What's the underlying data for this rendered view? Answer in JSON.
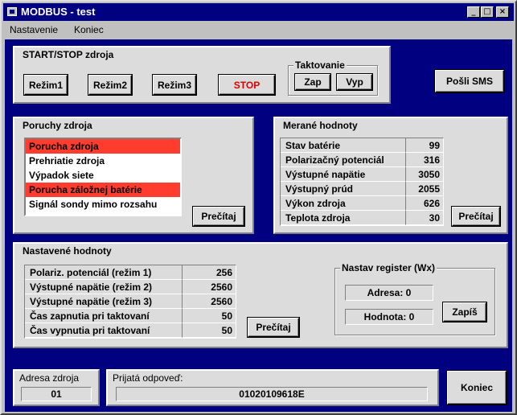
{
  "window": {
    "title": "MODBUS - test",
    "controls": {
      "minimize": "_",
      "maximize": "□",
      "close": "×"
    }
  },
  "menu": {
    "items": [
      "Nastavenie",
      "Koniec"
    ]
  },
  "startstop": {
    "title": "START/STOP zdroja",
    "buttons": [
      "Režim1",
      "Režim2",
      "Režim3",
      "STOP"
    ],
    "clocking": {
      "title": "Taktovanie",
      "on": "Zap",
      "off": "Vyp"
    }
  },
  "sms_button": "Pošli SMS",
  "faults": {
    "title": "Poruchy zdroja",
    "items": [
      {
        "label": "Porucha zdroja",
        "active": true
      },
      {
        "label": "Prehriatie zdroja",
        "active": false
      },
      {
        "label": "Výpadok siete",
        "active": false
      },
      {
        "label": "Porucha záložnej batérie",
        "active": true
      },
      {
        "label": "Signál sondy mimo rozsahu",
        "active": false
      }
    ],
    "read_button": "Prečítaj"
  },
  "measured": {
    "title": "Merané hodnoty",
    "rows": [
      {
        "label": "Stav batérie",
        "value": "99"
      },
      {
        "label": "Polarizačný potenciál",
        "value": "316"
      },
      {
        "label": "Výstupné napätie",
        "value": "3050"
      },
      {
        "label": "Výstupný prúd",
        "value": "2055"
      },
      {
        "label": "Výkon zdroja",
        "value": "626"
      },
      {
        "label": "Teplota zdroja",
        "value": "30"
      }
    ],
    "read_button": "Prečítaj"
  },
  "settings": {
    "title": "Nastavené hodnoty",
    "rows": [
      {
        "label": "Polariz. potenciál (režim 1)",
        "value": "256"
      },
      {
        "label": "Výstupné napätie (režim 2)",
        "value": "2560"
      },
      {
        "label": "Výstupné napätie (režim 3)",
        "value": "2560"
      },
      {
        "label": "Čas zapnutia pri taktovaní",
        "value": "50"
      },
      {
        "label": "Čas vypnutia pri taktovaní",
        "value": "50"
      }
    ],
    "read_button": "Prečítaj",
    "register": {
      "title": "Nastav register (Wx)",
      "address_label": "Adresa: 0",
      "value_label": "Hodnota: 0",
      "write_button": "Zapíš"
    }
  },
  "source_address": {
    "title": "Adresa zdroja",
    "value": "01"
  },
  "response": {
    "title": "Prijatá odpoveď:",
    "value": "01020109618E"
  },
  "exit_button": "Koniec",
  "colors": {
    "alarm": "#ff3c2d",
    "stop_text": "#e00000",
    "client_bg": "#000080",
    "titlebar": "#000080"
  }
}
